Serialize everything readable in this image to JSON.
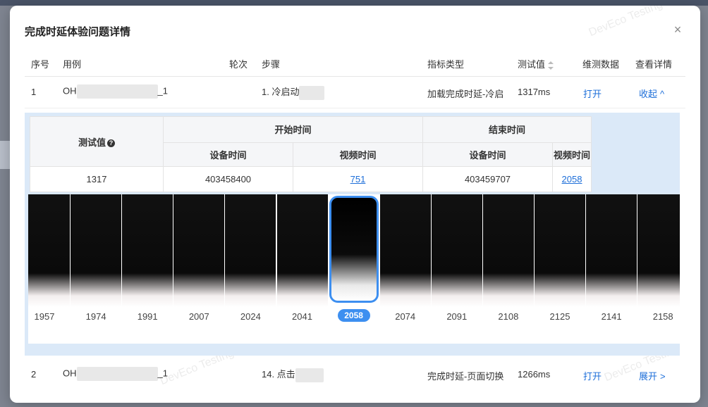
{
  "dialog": {
    "title": "完成时延体验问题详情",
    "close_icon": "×",
    "watermark": "DevEco Testing"
  },
  "table": {
    "headers": {
      "index": "序号",
      "case": "用例",
      "round": "轮次",
      "step": "步骤",
      "metric_type": "指标类型",
      "test_value": "测试值",
      "maintenance_data": "维测数据",
      "details": "查看详情"
    },
    "rows": [
      {
        "index": "1",
        "case_prefix": "OH",
        "case_suffix": "_1",
        "step": "1. 冷启动",
        "metric_type": "加载完成时延-冷启",
        "test_value": "1317ms",
        "open": "打开",
        "toggle": "收起",
        "toggle_icon": "^"
      },
      {
        "index": "2",
        "case_prefix": "OH",
        "case_suffix": "_1",
        "step": "14. 点击",
        "metric_type": "完成时延-页面切换",
        "test_value": "1266ms",
        "open": "打开",
        "toggle": "展开",
        "toggle_icon": ">"
      }
    ]
  },
  "detail": {
    "test_value_label": "测试值",
    "help_icon": "?",
    "start_time": "开始时间",
    "end_time": "结束时间",
    "device_time": "设备时间",
    "video_time": "视频时间",
    "test_value": "1317",
    "start_device_time": "403458400",
    "start_video_time": "751",
    "end_device_time": "403459707",
    "end_video_time": "2058"
  },
  "frames": {
    "labels": [
      "1957",
      "1974",
      "1991",
      "2007",
      "2024",
      "2041",
      "2058",
      "2074",
      "2091",
      "2108",
      "2125",
      "2141",
      "2158"
    ],
    "selected_index": 6
  }
}
